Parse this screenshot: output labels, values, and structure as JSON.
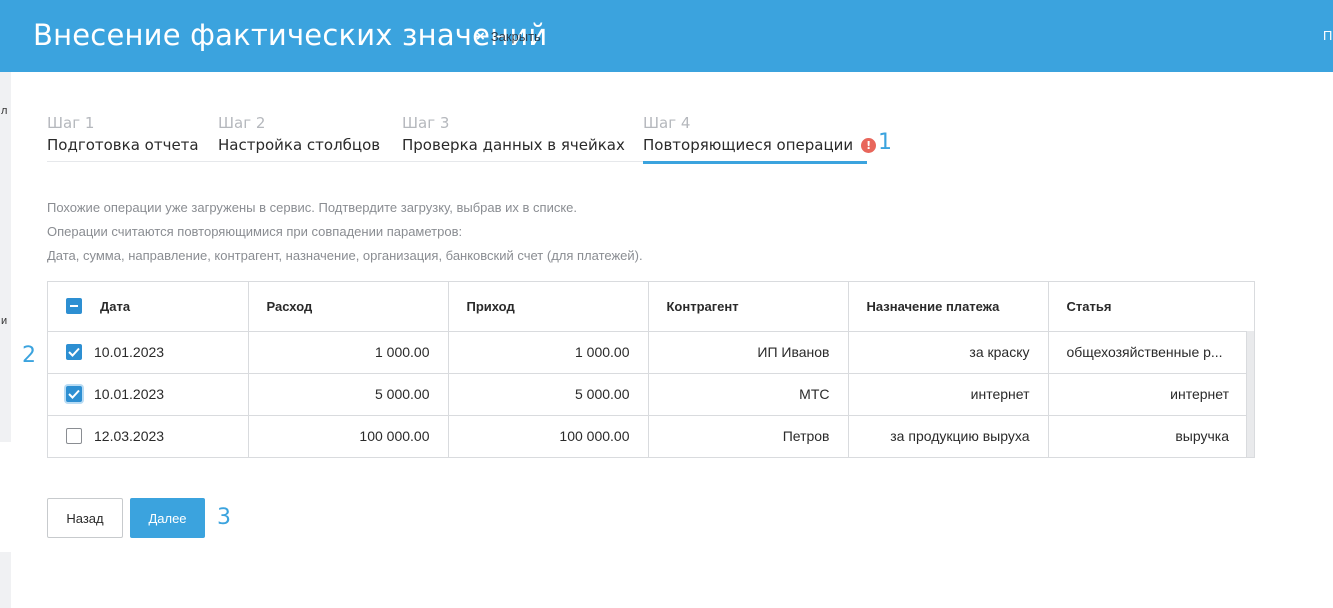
{
  "header": {
    "title": "Внесение фактических значений",
    "close_label": "Закрыть",
    "close_icon": "×",
    "right_fragment": "П"
  },
  "left_strip": {
    "fragment_top": "л",
    "fragment_mid": "и"
  },
  "steps": [
    {
      "num": "Шаг 1",
      "label": "Подготовка отчета"
    },
    {
      "num": "Шаг 2",
      "label": "Настройка столбцов"
    },
    {
      "num": "Шаг 3",
      "label": "Проверка данных в ячейках"
    },
    {
      "num": "Шаг 4",
      "label": "Повторяющиеся операции",
      "warning": "!"
    }
  ],
  "annotations": {
    "a1": "1",
    "a2": "2",
    "a3": "3"
  },
  "description": {
    "line1": "Похожие операции уже загружены в сервис. Подтвердите загрузку, выбрав их в списке.",
    "line2": "Операции считаются повторяющимися при совпадении параметров:",
    "line3": "Дата, сумма, направление, контрагент, назначение, организация, банковский счет (для платежей)."
  },
  "table": {
    "headers": {
      "date": "Дата",
      "expense": "Расход",
      "income": "Приход",
      "counterparty": "Контрагент",
      "purpose": "Назначение платежа",
      "article": "Статья"
    },
    "rows": [
      {
        "checked": true,
        "date": "10.01.2023",
        "expense": "1 000.00",
        "income": "1 000.00",
        "counterparty": "ИП Иванов",
        "purpose": "за краску",
        "article": "общехозяйственные р..."
      },
      {
        "checked": true,
        "date": "10.01.2023",
        "expense": "5 000.00",
        "income": "5 000.00",
        "counterparty": "МТС",
        "purpose": "интернет",
        "article": "интернет"
      },
      {
        "checked": false,
        "date": "12.03.2023",
        "expense": "100 000.00",
        "income": "100 000.00",
        "counterparty": "Петров",
        "purpose": "за продукцию выруха",
        "article": "выручка"
      }
    ]
  },
  "buttons": {
    "back": "Назад",
    "next": "Далее"
  },
  "colors": {
    "accent": "#3ba3de",
    "checkbox": "#2d8fd2",
    "warning": "#e8665b"
  }
}
